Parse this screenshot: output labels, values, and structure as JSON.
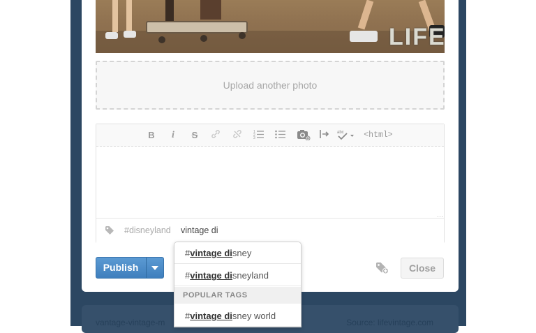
{
  "photo": {
    "watermark": "LIFE"
  },
  "upload": {
    "label": "Upload another photo"
  },
  "toolbar": {
    "bold": "B",
    "italic": "i",
    "strike": "S",
    "spell": "abc",
    "html": "<html>"
  },
  "tags": {
    "existing": "#disneyland",
    "input_value": "vintage di"
  },
  "autocomplete": {
    "items": [
      {
        "hash": "#",
        "match": "vintage di",
        "rest": "sney"
      },
      {
        "hash": "#",
        "match": "vintage di",
        "rest": "sneyland"
      }
    ],
    "popular_header": "POPULAR TAGS",
    "popular": [
      {
        "hash": "#",
        "match": "vintage di",
        "rest": "sney world"
      }
    ]
  },
  "actions": {
    "publish_label": "Publish",
    "close_label": "Close"
  },
  "next_post": {
    "left_text": "vantage-vintage-m",
    "right_text": "Source: lifevintage.com"
  },
  "colors": {
    "backdrop": "#2c4762",
    "publish": "#4a8ac8",
    "text_muted": "#a7a7a7"
  }
}
